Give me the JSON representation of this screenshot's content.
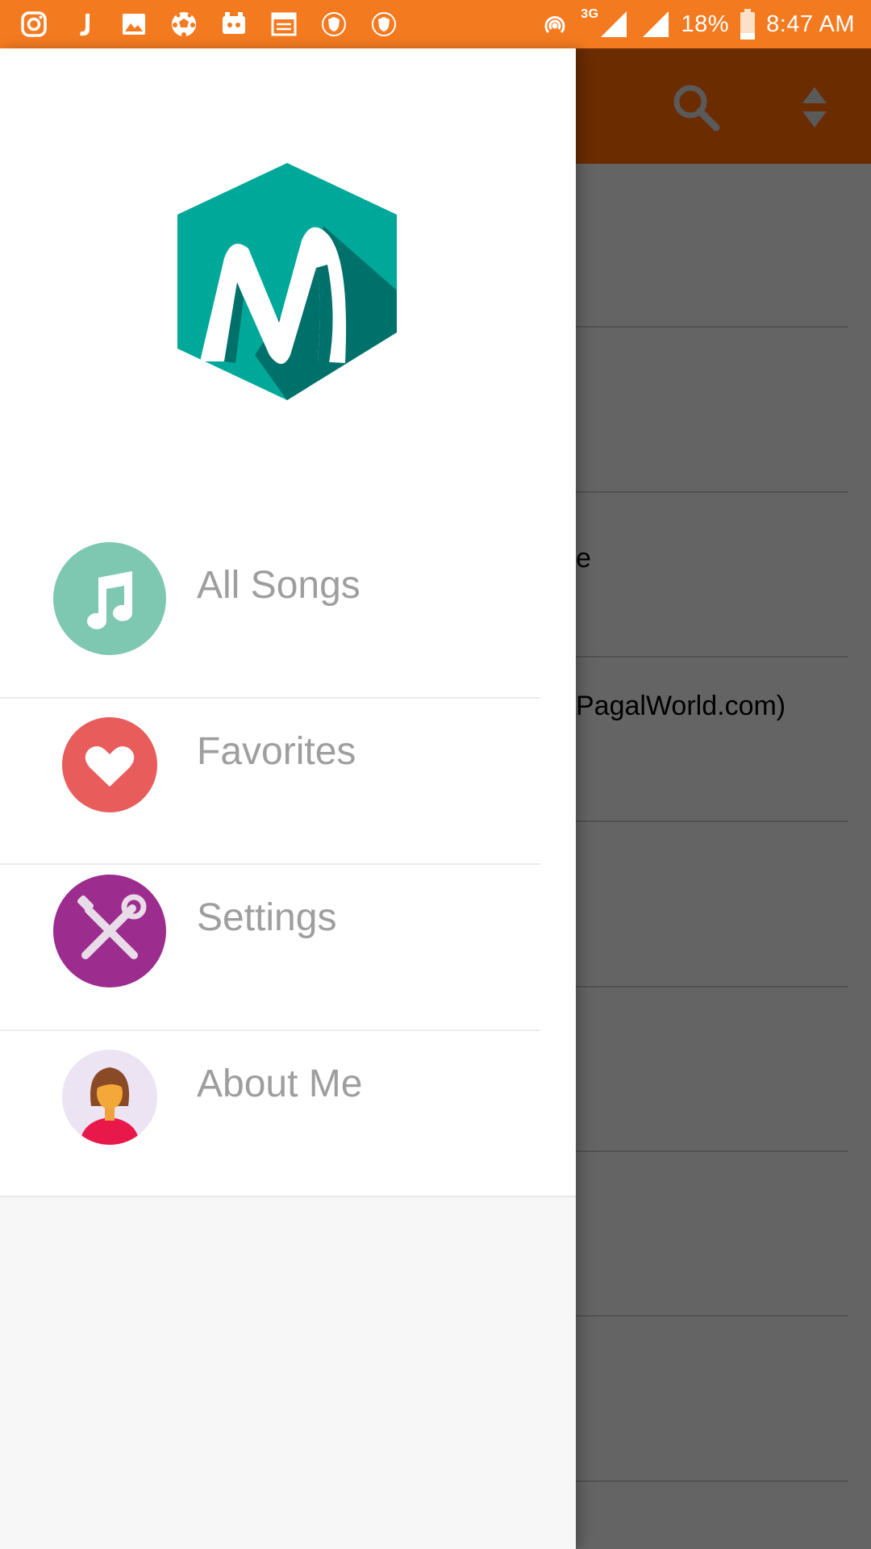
{
  "status_bar": {
    "left_icons": [
      "instagram-icon",
      "j-app-icon",
      "gallery-icon",
      "football-icon",
      "game-icon",
      "news-icon",
      "shield-icon",
      "shield-icon"
    ],
    "network_type": "3G",
    "battery": "18%",
    "time": "8:47 AM",
    "color": "#f47a20"
  },
  "toolbar": {
    "color": "#6b2c00",
    "icons": [
      "search-icon",
      "sort-icon"
    ]
  },
  "background_list": {
    "rows": [
      "",
      "",
      "e",
      "PagalWorld.com)",
      "",
      "",
      "",
      ""
    ]
  },
  "drawer": {
    "logo": "app-logo-m",
    "logo_colors": {
      "primary": "#00a89a",
      "shadow": "#00706a"
    },
    "items": [
      {
        "label": "All Songs",
        "icon": "music-note-icon",
        "color": "#7ec7b1"
      },
      {
        "label": "Favorites",
        "icon": "heart-icon",
        "color": "#e85c5c"
      },
      {
        "label": "Settings",
        "icon": "tools-icon",
        "color": "#9c2c8e"
      },
      {
        "label": "About Me",
        "icon": "person-icon",
        "color": "#ece3f3"
      }
    ]
  }
}
